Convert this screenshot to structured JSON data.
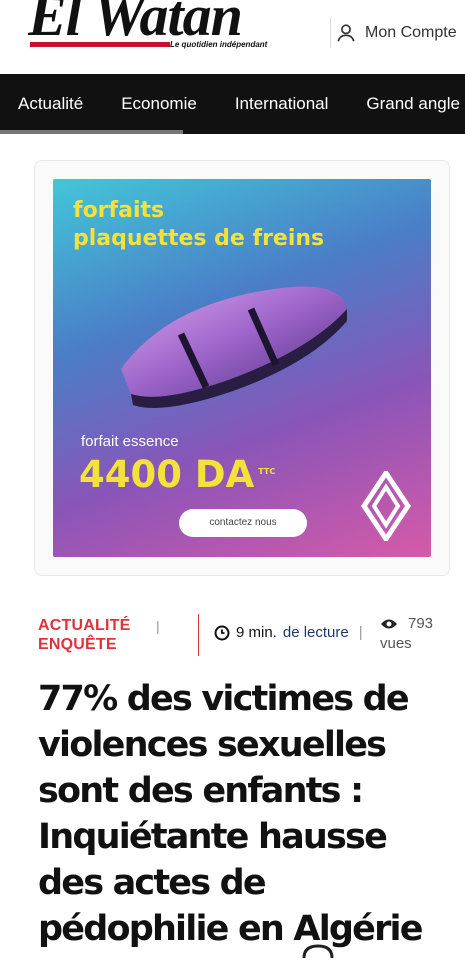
{
  "header": {
    "logo_text": "El Watan",
    "logo_tagline": "Le quotidien indépendant",
    "account_label": "Mon Compte"
  },
  "nav": {
    "items": [
      "Actualité",
      "Economie",
      "International",
      "Grand angle"
    ]
  },
  "ad": {
    "headline_line1": "forfaits",
    "headline_line2": "plaquettes de freins",
    "subline": "forfait essence",
    "price": "4400 DA",
    "price_suffix": "TTC",
    "button": "contactez nous"
  },
  "article": {
    "category_line1": "ACTUALITÉ",
    "category_line2": "ENQUÊTE",
    "read_time": "9 min.",
    "read_label": "de lecture",
    "views_count": "793",
    "views_label": "vues",
    "title": "77% des victimes de violences sexuelles sont des enfants : Inquiétante hausse des actes de pédophilie en Algérie"
  },
  "colors": {
    "accent_red": "#e0323a",
    "nav_bg": "#111111",
    "ad_yellow": "#f3e23a"
  }
}
